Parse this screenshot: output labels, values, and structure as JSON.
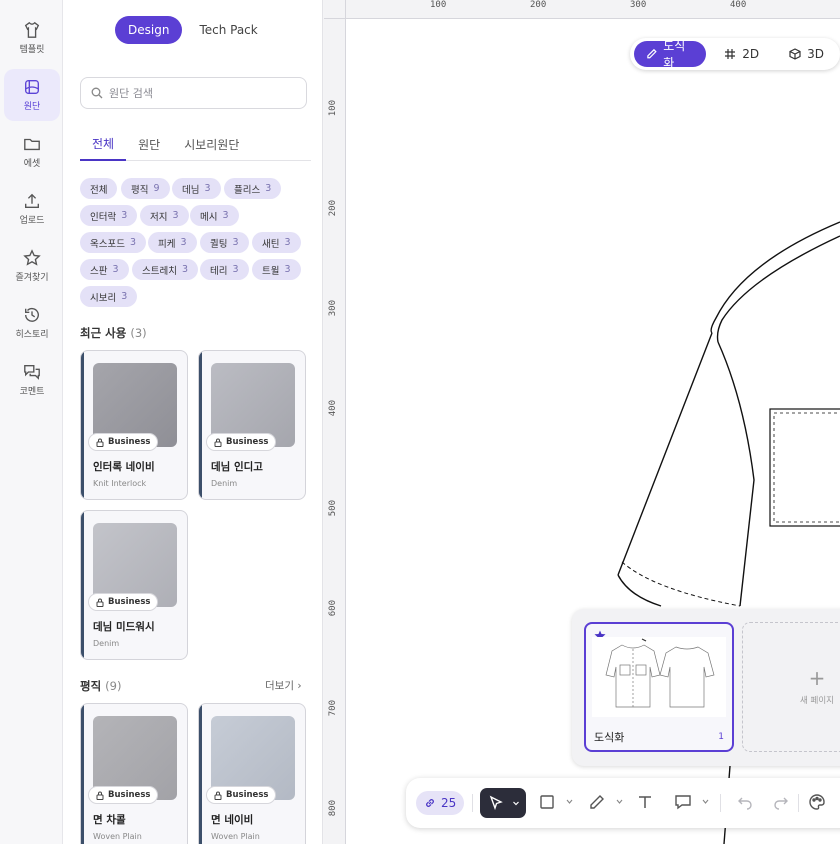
{
  "rail": {
    "items": [
      {
        "label": "템플릿",
        "icon": "shirt-icon"
      },
      {
        "label": "원단",
        "icon": "fabric-icon"
      },
      {
        "label": "에셋",
        "icon": "folder-icon"
      },
      {
        "label": "업로드",
        "icon": "upload-icon"
      },
      {
        "label": "즐겨찾기",
        "icon": "star-icon"
      },
      {
        "label": "히스토리",
        "icon": "history-icon"
      },
      {
        "label": "코멘트",
        "icon": "comment-icon"
      }
    ],
    "active_index": 1
  },
  "panel": {
    "mode_tabs": [
      "Design",
      "Tech Pack"
    ],
    "search_placeholder": "원단 검색",
    "category_tabs": [
      "전체",
      "원단",
      "시보리원단"
    ],
    "chips": [
      {
        "label": "전체",
        "count": ""
      },
      {
        "label": "평직",
        "count": "9"
      },
      {
        "label": "데님",
        "count": "3"
      },
      {
        "label": "플리스",
        "count": "3"
      },
      {
        "label": "인터락",
        "count": "3"
      },
      {
        "label": "저지",
        "count": "3"
      },
      {
        "label": "메시",
        "count": "3"
      },
      {
        "label": "옥스포드",
        "count": "3"
      },
      {
        "label": "피케",
        "count": "3"
      },
      {
        "label": "퀼팅",
        "count": "3"
      },
      {
        "label": "새틴",
        "count": "3"
      },
      {
        "label": "스판",
        "count": "3"
      },
      {
        "label": "스트레치",
        "count": "3"
      },
      {
        "label": "테리",
        "count": "3"
      },
      {
        "label": "트윌",
        "count": "3"
      },
      {
        "label": "시보리",
        "count": "3"
      }
    ],
    "recent": {
      "title": "최근 사용",
      "count": "(3)",
      "items": [
        {
          "name": "인터록 네이비",
          "sub": "Knit Interlock",
          "badge": "Business"
        },
        {
          "name": "데님 인디고",
          "sub": "Denim",
          "badge": "Business"
        },
        {
          "name": "데님 미드워시",
          "sub": "Denim",
          "badge": "Business"
        }
      ]
    },
    "plain": {
      "title": "평직",
      "count": "(9)",
      "more": "더보기 ›",
      "items": [
        {
          "name": "면 차콜",
          "sub": "Woven Plain",
          "badge": "Business"
        },
        {
          "name": "면 네이비",
          "sub": "Woven Plain",
          "badge": "Business"
        }
      ]
    }
  },
  "canvas": {
    "ruler_top": [
      "100",
      "200",
      "300",
      "400"
    ],
    "ruler_left": [
      "100",
      "200",
      "300",
      "400",
      "500",
      "600",
      "700",
      "800"
    ],
    "view_modes": [
      {
        "label": "도식화",
        "icon": "pencil-icon"
      },
      {
        "label": "2D",
        "icon": "grid-icon"
      },
      {
        "label": "3D",
        "icon": "cube-icon"
      }
    ],
    "pages": {
      "current": {
        "name": "도식화",
        "number": "1"
      },
      "new_label": "새 페이지"
    },
    "toolbar": {
      "zoom": "25"
    }
  },
  "colors": {
    "accent": "#5b3fd4",
    "chip_bg": "#e4e1f7",
    "dark_tool": "#2c2d3a"
  }
}
